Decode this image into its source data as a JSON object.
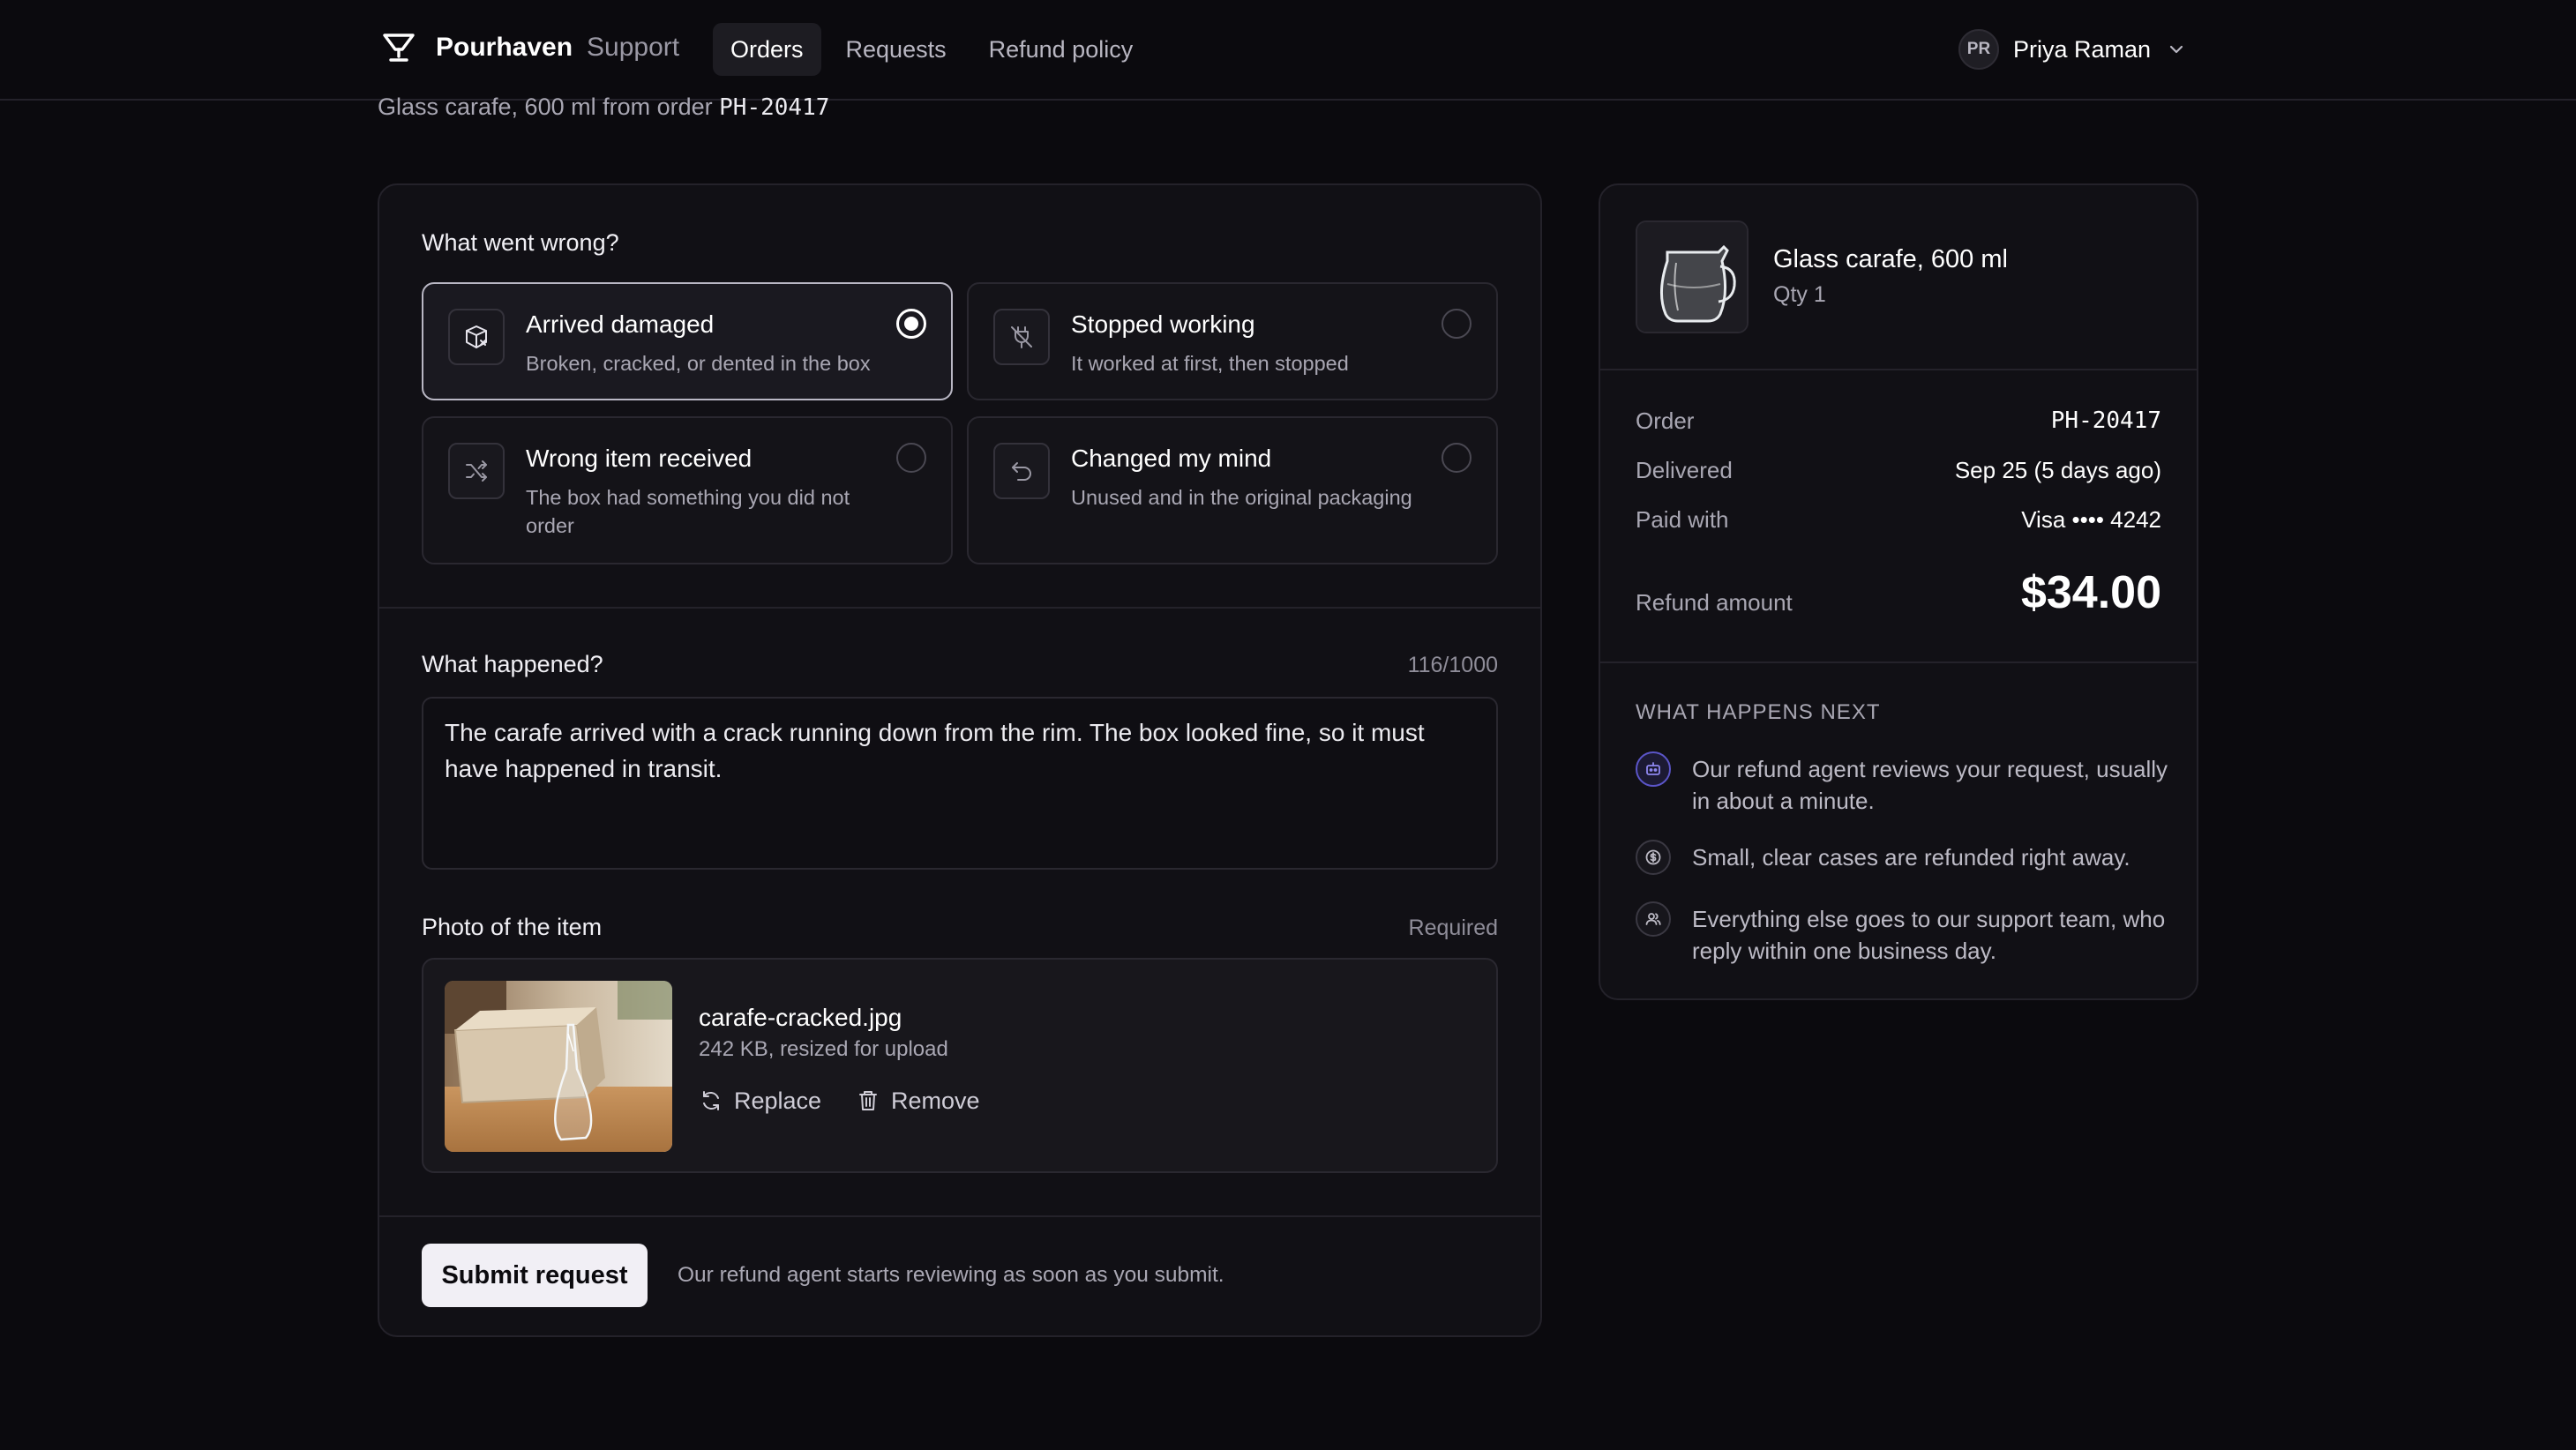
{
  "header": {
    "brand_name": "Pourhaven",
    "brand_sub": "Support",
    "nav": [
      {
        "label": "Orders",
        "active": true
      },
      {
        "label": "Requests",
        "active": false
      },
      {
        "label": "Refund policy",
        "active": false
      }
    ],
    "user": {
      "initials": "PR",
      "name": "Priya Raman"
    }
  },
  "subtitle": {
    "prefix": "Glass carafe, 600 ml from order",
    "order_id": "PH-20417"
  },
  "form": {
    "reason_label": "What went wrong?",
    "reasons": [
      {
        "title": "Arrived damaged",
        "desc": "Broken, cracked, or dented in the box",
        "selected": true,
        "icon": "package-damaged-icon"
      },
      {
        "title": "Stopped working",
        "desc": "It worked at first, then stopped",
        "selected": false,
        "icon": "plug-off-icon"
      },
      {
        "title": "Wrong item received",
        "desc": "The box had something you did not order",
        "selected": false,
        "icon": "shuffle-icon"
      },
      {
        "title": "Changed my mind",
        "desc": "Unused and in the original packaging",
        "selected": false,
        "icon": "undo-icon"
      }
    ],
    "details_label": "What happened?",
    "details_counter": "116/1000",
    "details_text": "The carafe arrived with a crack running down from the rim. The box looked fine, so it must have happened in transit.",
    "photo_label": "Photo of the item",
    "photo_required": "Required",
    "photo": {
      "file_name": "carafe-cracked.jpg",
      "meta": "242 KB, resized for upload",
      "replace_label": "Replace",
      "remove_label": "Remove"
    },
    "submit_label": "Submit request",
    "submit_note": "Our refund agent starts reviewing as soon as you submit."
  },
  "summary": {
    "product_name": "Glass carafe, 600 ml",
    "product_qty": "Qty 1",
    "rows": [
      {
        "label": "Order",
        "value": "PH-20417"
      },
      {
        "label": "Delivered",
        "value": "Sep 25 (5 days ago)"
      },
      {
        "label": "Paid with",
        "value": "Visa •••• 4242"
      }
    ],
    "refund_label": "Refund amount",
    "refund_value": "$34.00",
    "next_title": "WHAT HAPPENS NEXT",
    "steps": [
      {
        "text": "Our refund agent reviews your request, usually in about a minute.",
        "icon": "robot-icon"
      },
      {
        "text": "Small, clear cases are refunded right away.",
        "icon": "dollar-icon"
      },
      {
        "text": "Everything else goes to our support team, who reply within one business day.",
        "icon": "users-icon"
      }
    ]
  },
  "colors": {
    "background": "#0b0a0e",
    "card": "#111015",
    "border": "#24222a",
    "accent": "#5b55c8",
    "button": "#f1eff5"
  }
}
